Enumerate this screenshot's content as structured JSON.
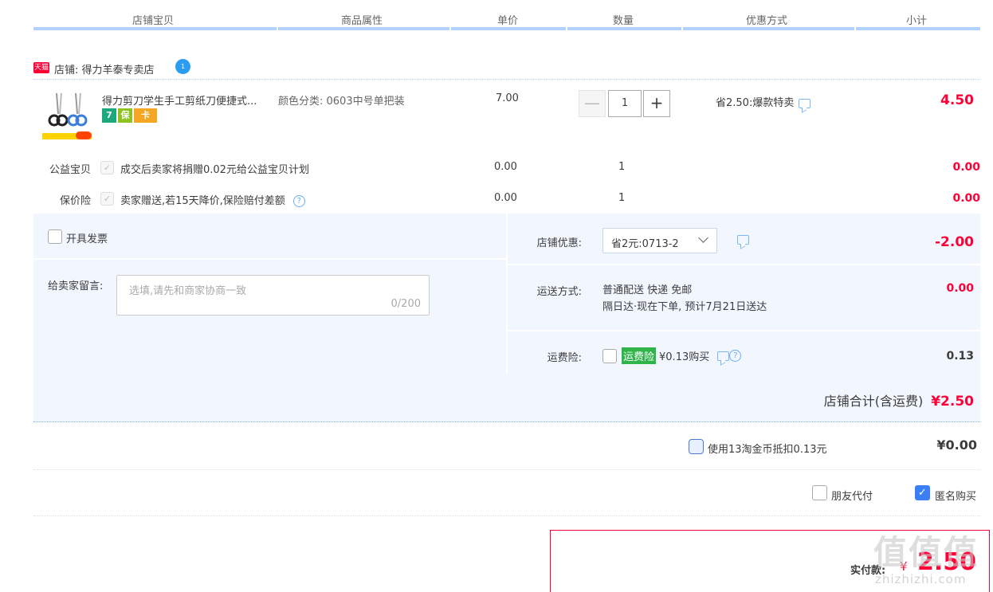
{
  "columns": [
    "店铺宝贝",
    "商品属性",
    "单价",
    "数量",
    "优惠方式",
    "小计"
  ],
  "shop": {
    "badge": "天猫",
    "name": "店铺: 得力羊泰专卖店",
    "ww_badge": "1"
  },
  "item": {
    "title": "得力剪刀学生手工剪纸刀便捷式...",
    "service_icons": [
      "7",
      "保",
      "卡"
    ],
    "property": "颜色分类: 0603中号单把装",
    "price": "7.00",
    "quantity": "1",
    "minus": "—",
    "plus": "+",
    "promotion": "省2.50:爆款特卖",
    "subtotal": "4.50"
  },
  "services": [
    {
      "label": "公益宝贝",
      "desc": "成交后卖家将捐赠0.02元给公益宝贝计划",
      "price": "0.00",
      "qty": "1",
      "subtotal": "0.00",
      "help": false
    },
    {
      "label": "保价险",
      "desc": "卖家赠送,若15天降价,保险赔付差额",
      "price": "0.00",
      "qty": "1",
      "subtotal": "0.00",
      "help": true
    }
  ],
  "order": {
    "invoice_label": "开具发票",
    "message_label": "给卖家留言:",
    "message_placeholder": "选填,请先和商家协商一致",
    "message_count": "0/200",
    "shop_discount_label": "店铺优惠:",
    "shop_discount_value": "省2元:0713-2",
    "shop_discount_amount": "-2.00",
    "shipping_label": "运送方式:",
    "shipping_line1": "普通配送 快递 免邮",
    "shipping_line2": "隔日达·现在下单, 预计7月21日送达",
    "shipping_amount": "0.00",
    "freight_label": "运费险:",
    "freight_tag": "运费险",
    "freight_text": "¥0.13购买",
    "freight_amount": "0.13",
    "shop_total_label": "店铺合计(含运费)",
    "shop_total_value": "¥2.50"
  },
  "coins": {
    "text": "使用13淘金币抵扣0.13元",
    "value": "¥0.00"
  },
  "options": {
    "friend_pay": "朋友代付",
    "anonymous": "匿名购买",
    "anonymous_checked": "✓"
  },
  "payment": {
    "label": "实付款:",
    "currency": "¥",
    "amount": "2.50"
  },
  "watermark": {
    "logo": "值值值",
    "site": "zhizhizhi.com"
  },
  "colors": {
    "accent": "#ff0036",
    "header_bar": "#b2d1ff",
    "panel_bg": "#f2f7ff",
    "checkbox_checked": "#3a7ff5"
  }
}
